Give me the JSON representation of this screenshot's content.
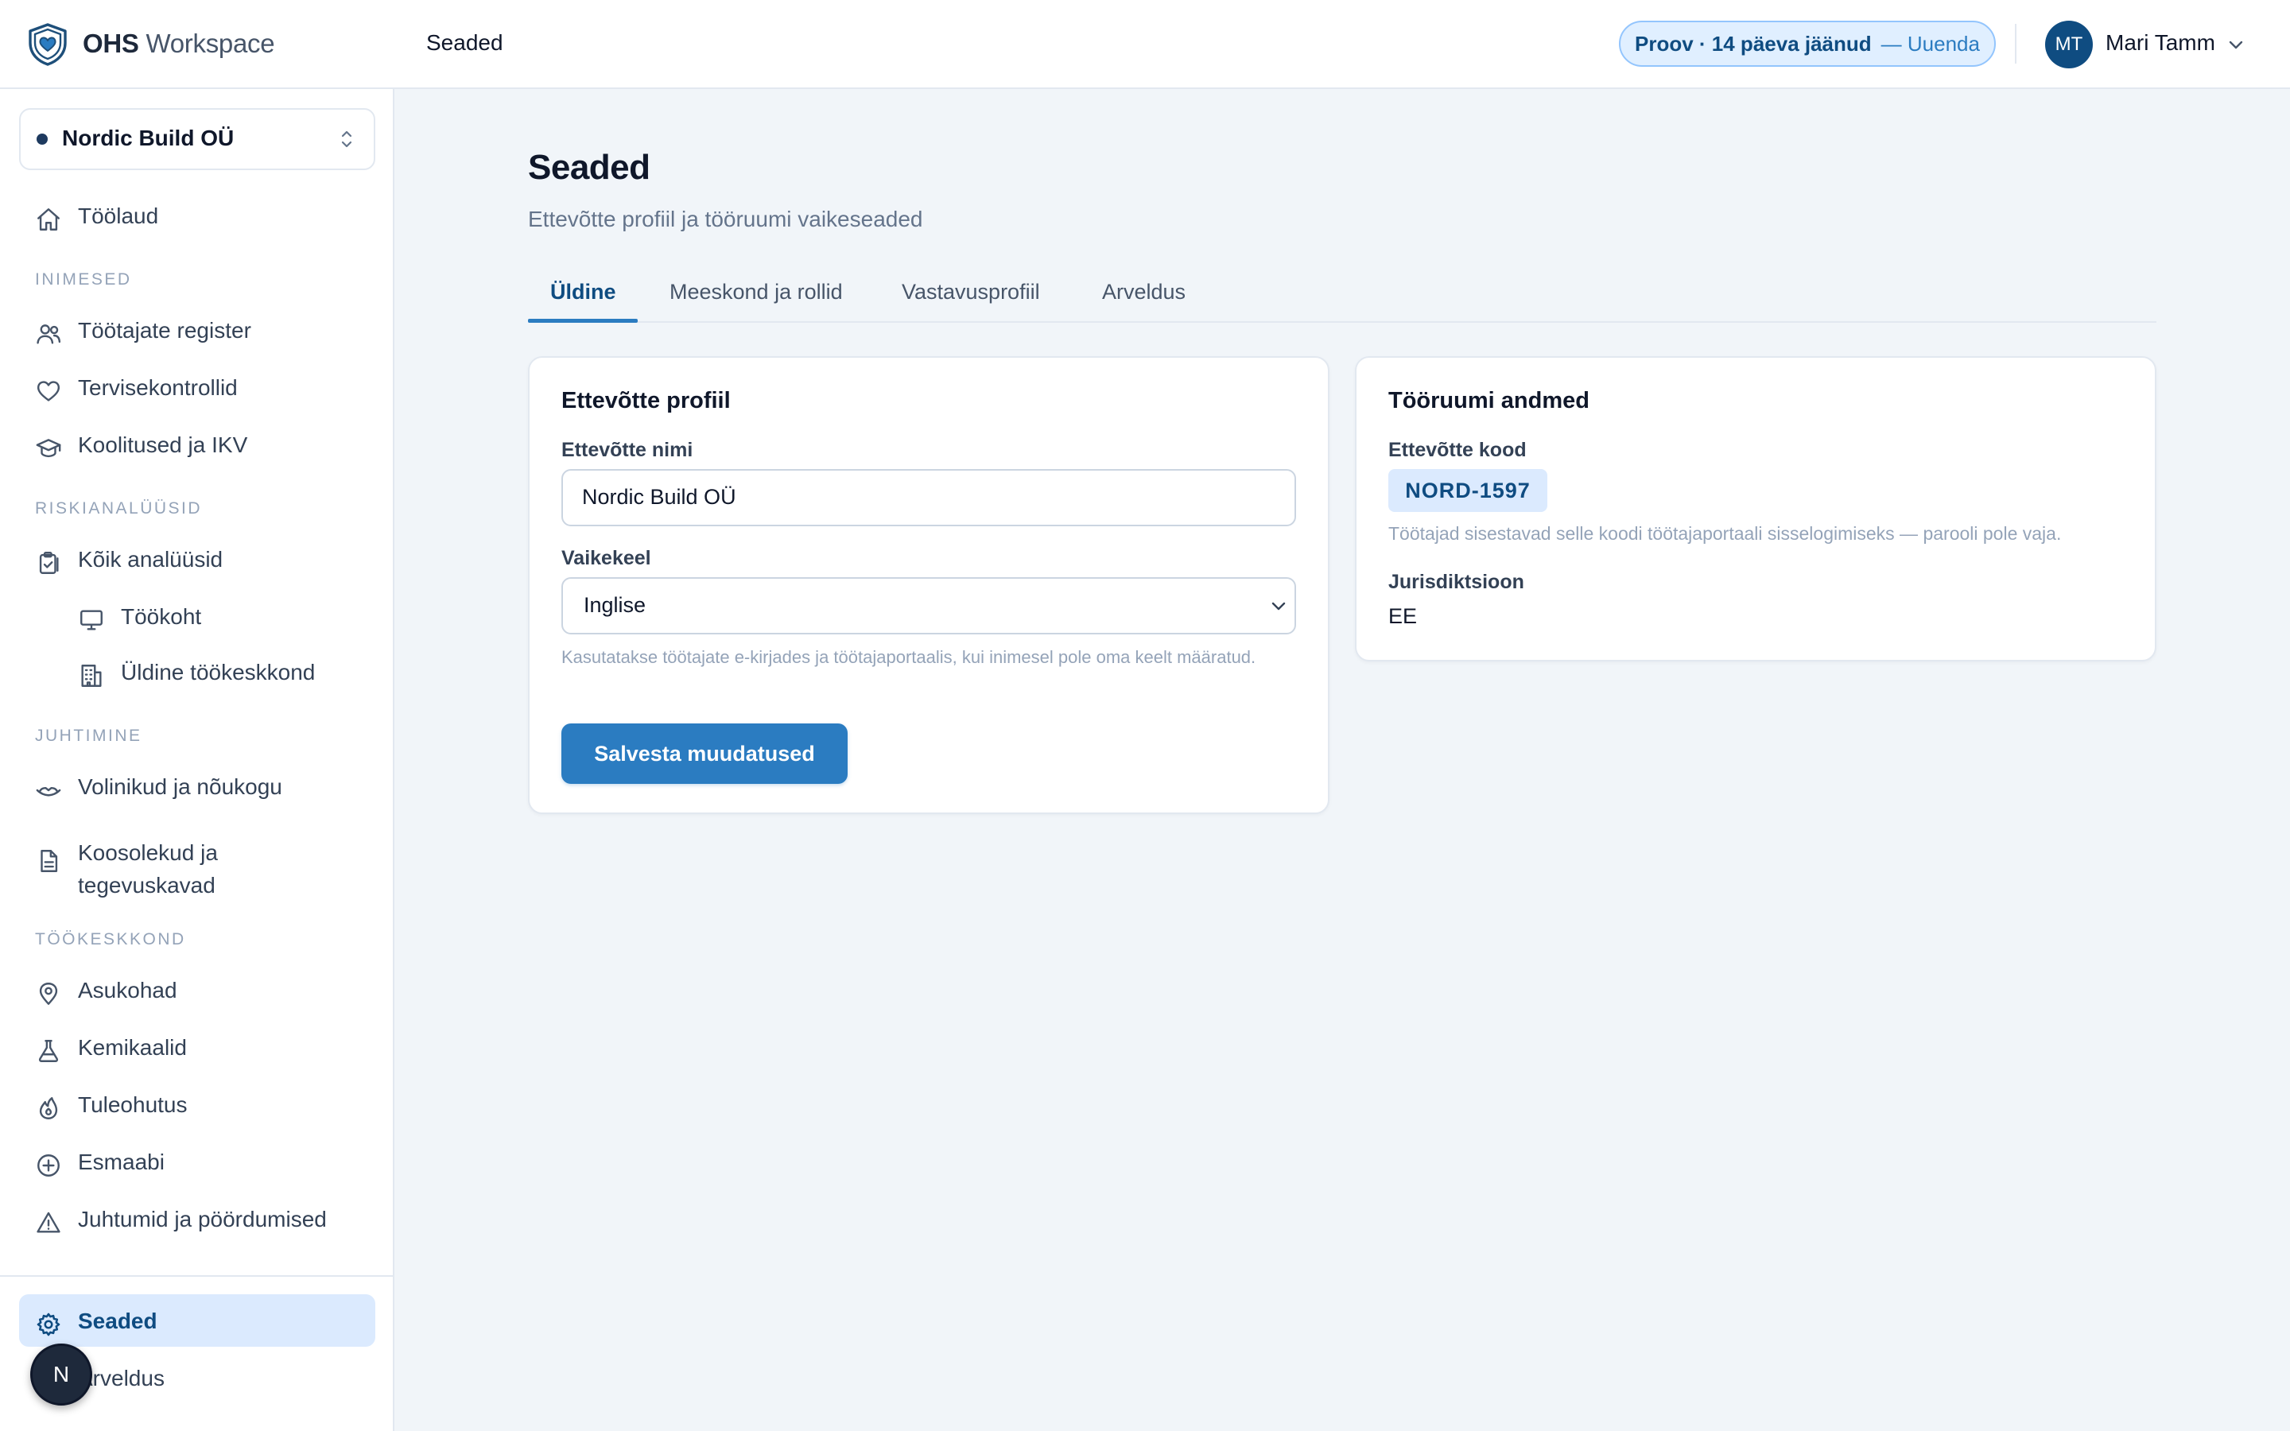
{
  "app": {
    "name_bold": "OHS",
    "name_light": "Workspace",
    "logo_icon": "shield-heart-icon"
  },
  "header": {
    "title": "Seaded",
    "trial_text": "Proov · 14 päeva jäänud",
    "trial_action": "— Uuenda",
    "user_initials": "MT",
    "user_name": "Mari Tamm"
  },
  "sidebar": {
    "org_name": "Nordic Build OÜ",
    "home": {
      "label": "Töölaud",
      "icon": "home-icon"
    },
    "sections": [
      {
        "title": "INIMESED",
        "items": [
          {
            "label": "Töötajate register",
            "icon": "users-icon"
          },
          {
            "label": "Tervisekontrollid",
            "icon": "heart-icon"
          },
          {
            "label": "Koolitused ja IKV",
            "icon": "graduation-cap-icon"
          }
        ]
      },
      {
        "title": "RISKIANALÜÜSID",
        "items": [
          {
            "label": "Kõik analüüsid",
            "icon": "clipboard-icon"
          },
          {
            "label": "Töökoht",
            "icon": "monitor-icon"
          },
          {
            "label": "Üldine töökeskkond",
            "icon": "building-icon"
          }
        ]
      },
      {
        "title": "JUHTIMINE",
        "items": [
          {
            "label": "Volinikud ja nõukogu",
            "icon": "handshake-icon"
          },
          {
            "label": "Koosolekud ja tegevuskavad",
            "icon": "document-icon"
          }
        ]
      },
      {
        "title": "TÖÖKESKKOND",
        "items": [
          {
            "label": "Asukohad",
            "icon": "map-pin-icon"
          },
          {
            "label": "Kemikaalid",
            "icon": "flask-icon"
          },
          {
            "label": "Tuleohutus",
            "icon": "flame-icon"
          },
          {
            "label": "Esmaabi",
            "icon": "plus-circle-icon"
          },
          {
            "label": "Juhtumid ja pöördumised",
            "icon": "warning-icon"
          }
        ]
      }
    ],
    "footer": [
      {
        "label": "Seaded",
        "icon": "gear-icon",
        "active": true
      },
      {
        "label": "Arveldus",
        "icon": "credit-card-icon"
      }
    ],
    "floating_badge": "N"
  },
  "main": {
    "title": "Seaded",
    "subtitle": "Ettevõtte profiil ja tööruumi vaikeseaded",
    "tabs": [
      {
        "label": "Üldine",
        "active": true
      },
      {
        "label": "Meeskond ja rollid"
      },
      {
        "label": "Vastavusprofiil"
      },
      {
        "label": "Arveldus"
      }
    ],
    "profile_card": {
      "title": "Ettevõtte profiil",
      "company_name_label": "Ettevõtte nimi",
      "company_name_value": "Nordic Build OÜ",
      "language_label": "Vaikekeel",
      "language_value": "Inglise",
      "language_help": "Kasutatakse töötajate e-kirjades ja töötajaportaalis, kui inimesel pole oma keelt määratud.",
      "save_label": "Salvesta muudatused"
    },
    "workspace_card": {
      "title": "Tööruumi andmed",
      "code_label": "Ettevõtte kood",
      "code_value": "NORD-1597",
      "code_help": "Töötajad sisestavad selle koodi töötajaportaali sisselogimiseks — parooli pole vaja.",
      "jurisdiction_label": "Jurisdiktsioon",
      "jurisdiction_value": "EE"
    }
  },
  "colors": {
    "primary": "#2b7cc1",
    "primary_dark": "#0f4c81",
    "active_bg": "#dbeafe"
  }
}
